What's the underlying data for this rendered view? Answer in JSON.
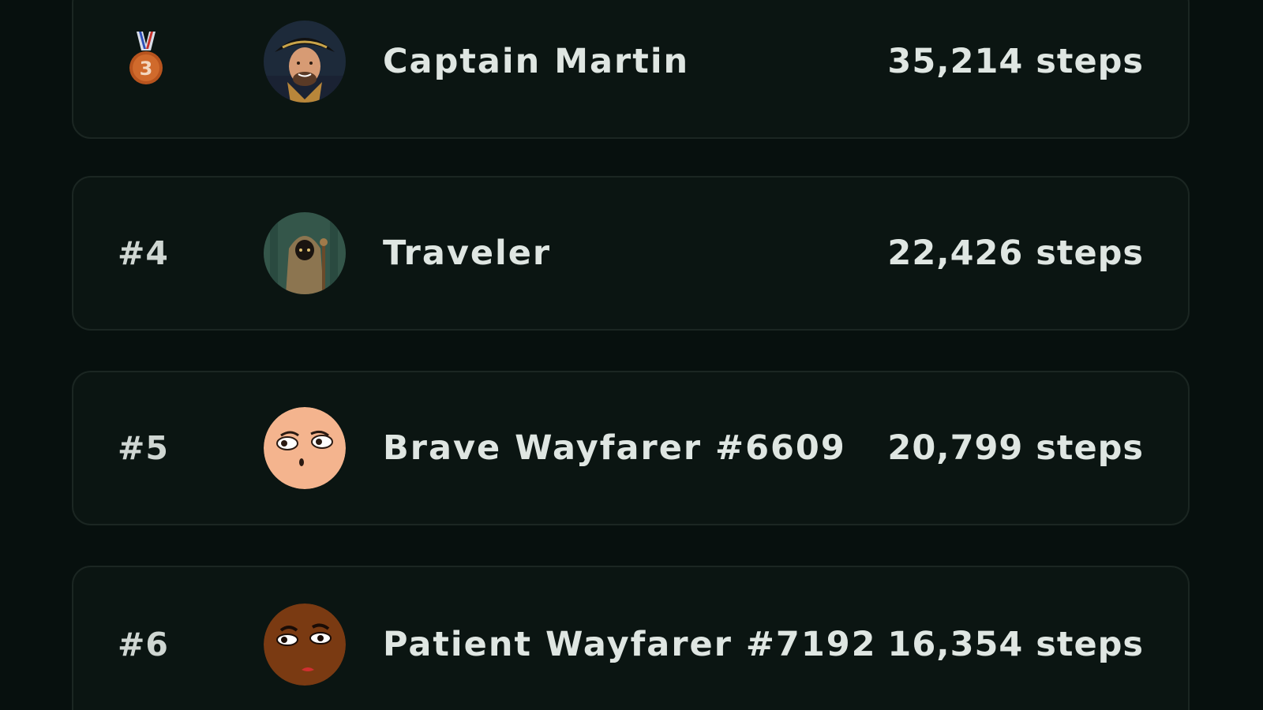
{
  "leaderboard": {
    "entries": [
      {
        "rank": "#3",
        "medal": "bronze-medal",
        "medal_number": "3",
        "name": "Captain Martin",
        "steps": "35,214 steps",
        "avatar": "pirate-captain-avatar"
      },
      {
        "rank": "#4",
        "name": "Traveler",
        "steps": "22,426 steps",
        "avatar": "hooded-traveler-avatar"
      },
      {
        "rank": "#5",
        "name": "Brave Wayfarer #6609",
        "steps": "20,799 steps",
        "avatar": "peach-face-avatar",
        "avatar_color": "#f4b48e"
      },
      {
        "rank": "#6",
        "name": "Patient Wayfarer #7192",
        "steps": "16,354 steps",
        "avatar": "brown-face-avatar",
        "avatar_color": "#7a3a12"
      }
    ]
  },
  "colors": {
    "background": "#07100e",
    "card": "#0b1512",
    "card_border": "#1b2622",
    "text": "#dfe6e2",
    "bronze": "#c8622a"
  }
}
